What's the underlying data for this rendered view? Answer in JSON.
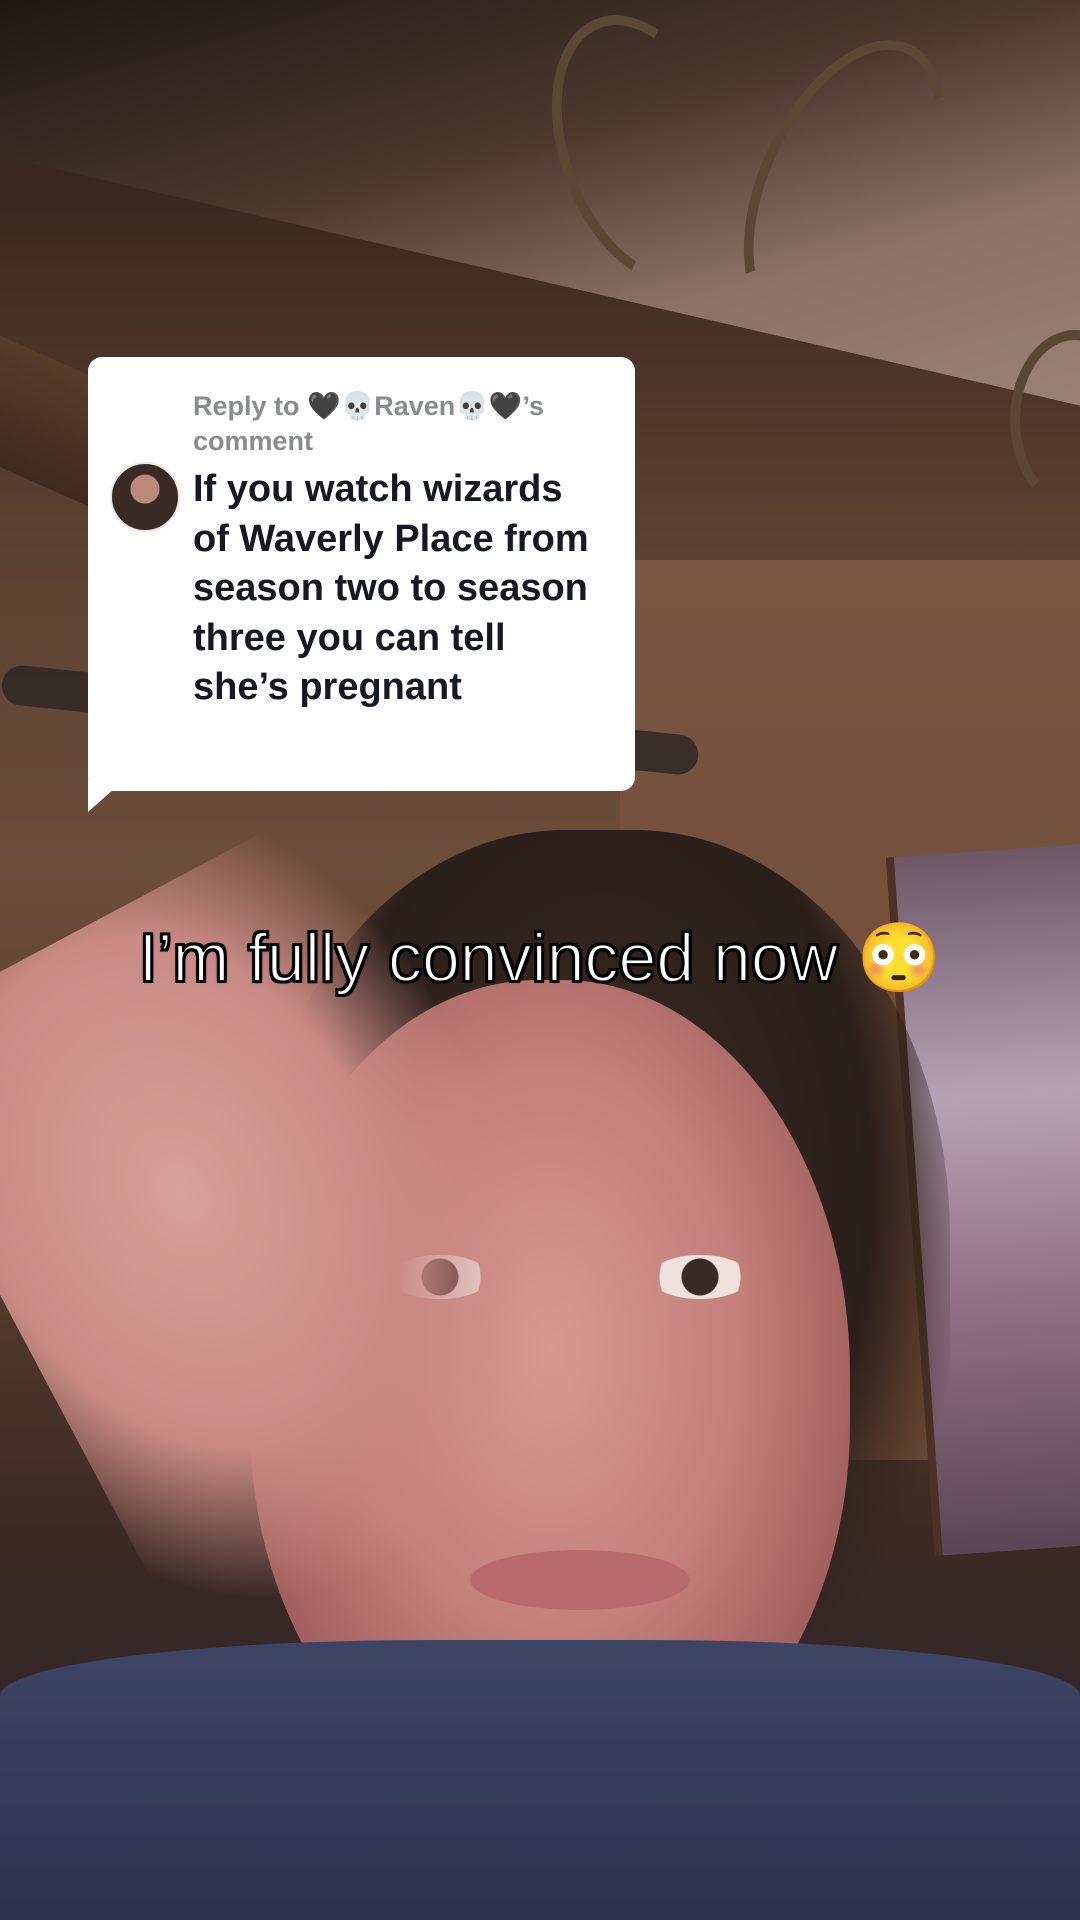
{
  "reply_sticker": {
    "header": "Reply to 🖤💀Raven💀🖤’s comment",
    "comment_text": "If you watch wizards of Waverly Place from season two to season three you can tell she’s pregnant"
  },
  "caption": {
    "text": "I’m fully convinced now",
    "emoji": "😳"
  },
  "colors": {
    "sticker_background": "#ffffff",
    "sticker_header_text": "#8a8b91",
    "sticker_body_text": "#161823",
    "caption_text": "#ffffff",
    "caption_outline": "#000000"
  }
}
